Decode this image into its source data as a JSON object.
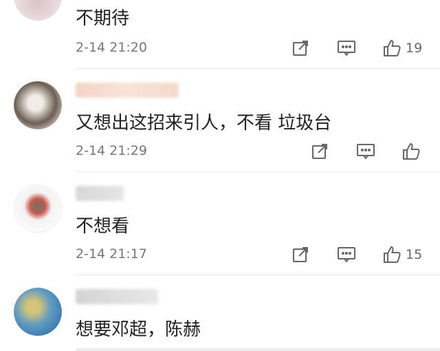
{
  "comments": [
    {
      "content": "不期待",
      "time": "2-14 21:20",
      "likes": "19"
    },
    {
      "content": "又想出这招来引人，不看 垃圾台",
      "time": "2-14 21:29",
      "likes": ""
    },
    {
      "content": "不想看",
      "time": "2-14 21:17",
      "likes": "15"
    },
    {
      "content": "想要邓超，陈赫",
      "time": "",
      "likes": ""
    }
  ],
  "icons": {
    "share": "share-icon",
    "reply": "comment-icon",
    "like": "thumbs-up-icon"
  },
  "colors": {
    "text": "#222222",
    "meta": "#777777",
    "divider": "#e9e9e9"
  }
}
